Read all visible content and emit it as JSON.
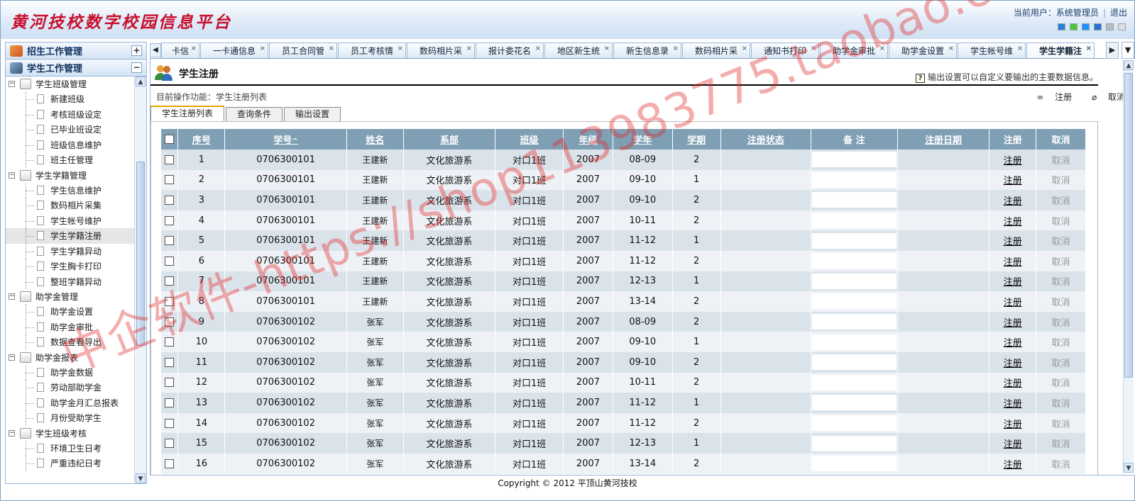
{
  "header": {
    "logo_text": "黄河技校数字校园信息平台",
    "user_label": "当前用户：系统管理员",
    "logout": "退出",
    "skin_colors": [
      "#2f7ed8",
      "#55c43b",
      "#1e90ff",
      "#2c6fd1",
      "#bbbbbb",
      "#dddddd"
    ]
  },
  "sidebar": {
    "sections": [
      {
        "label": "招生工作管理",
        "toggle": "+"
      },
      {
        "label": "学生工作管理",
        "toggle": "−"
      }
    ],
    "groups": [
      {
        "label": "学生班级管理",
        "items": [
          "新建班级",
          "考核班级设定",
          "已毕业班设定",
          "班级信息维护",
          "班主任管理"
        ]
      },
      {
        "label": "学生学籍管理",
        "items": [
          "学生信息维护",
          "数码相片采集",
          "学生帐号维护",
          "学生学籍注册",
          "学生学籍异动",
          "学生胸卡打印",
          "整班学籍异动"
        ]
      },
      {
        "label": "助学金管理",
        "items": [
          "助学金设置",
          "助学金审批",
          "数据查看导出"
        ]
      },
      {
        "label": "助学金报表",
        "items": [
          "助学金数据",
          "劳动部助学金",
          "助学金月汇总报表",
          "月份受助学生"
        ]
      },
      {
        "label": "学生班级考核",
        "items": [
          "环境卫生日考",
          "严重违纪日考"
        ]
      }
    ],
    "active_item": "学生学籍注册"
  },
  "tabs": [
    "卡信",
    "一卡通信息",
    "员工合同管",
    "员工考核情",
    "数码相片采",
    "报计委花名",
    "地区新生统",
    "新生信息录",
    "数码相片采",
    "通知书打印",
    "助学金审批",
    "助学金设置",
    "学生帐号维",
    "学生学籍注"
  ],
  "active_tab": "学生学籍注",
  "page": {
    "title": "学生注册",
    "hint": "输出设置可以自定义要输出的主要数据信息。",
    "crumb": "目前操作功能：学生注册列表",
    "action_register": "注册",
    "action_cancel": "取消"
  },
  "subtabs": [
    "学生注册列表",
    "查询条件",
    "输出设置"
  ],
  "table": {
    "headers": [
      "序号",
      "学号",
      "姓名",
      "系部",
      "班级",
      "年级",
      "学年",
      "学期",
      "注册状态",
      "备 注",
      "注册日期",
      "注册",
      "取消"
    ],
    "sort_mark": "^",
    "link_register": "注册",
    "link_cancel": "取消",
    "rows": [
      [
        "1",
        "0706300101",
        "王建新",
        "文化旅游系",
        "对口1班",
        "2007",
        "08-09",
        "2"
      ],
      [
        "2",
        "0706300101",
        "王建新",
        "文化旅游系",
        "对口1班",
        "2007",
        "09-10",
        "1"
      ],
      [
        "3",
        "0706300101",
        "王建新",
        "文化旅游系",
        "对口1班",
        "2007",
        "09-10",
        "2"
      ],
      [
        "4",
        "0706300101",
        "王建新",
        "文化旅游系",
        "对口1班",
        "2007",
        "10-11",
        "2"
      ],
      [
        "5",
        "0706300101",
        "王建新",
        "文化旅游系",
        "对口1班",
        "2007",
        "11-12",
        "1"
      ],
      [
        "6",
        "0706300101",
        "王建新",
        "文化旅游系",
        "对口1班",
        "2007",
        "11-12",
        "2"
      ],
      [
        "7",
        "0706300101",
        "王建新",
        "文化旅游系",
        "对口1班",
        "2007",
        "12-13",
        "1"
      ],
      [
        "8",
        "0706300101",
        "王建新",
        "文化旅游系",
        "对口1班",
        "2007",
        "13-14",
        "2"
      ],
      [
        "9",
        "0706300102",
        "张军",
        "文化旅游系",
        "对口1班",
        "2007",
        "08-09",
        "2"
      ],
      [
        "10",
        "0706300102",
        "张军",
        "文化旅游系",
        "对口1班",
        "2007",
        "09-10",
        "1"
      ],
      [
        "11",
        "0706300102",
        "张军",
        "文化旅游系",
        "对口1班",
        "2007",
        "09-10",
        "2"
      ],
      [
        "12",
        "0706300102",
        "张军",
        "文化旅游系",
        "对口1班",
        "2007",
        "10-11",
        "2"
      ],
      [
        "13",
        "0706300102",
        "张军",
        "文化旅游系",
        "对口1班",
        "2007",
        "11-12",
        "1"
      ],
      [
        "14",
        "0706300102",
        "张军",
        "文化旅游系",
        "对口1班",
        "2007",
        "11-12",
        "2"
      ],
      [
        "15",
        "0706300102",
        "张军",
        "文化旅游系",
        "对口1班",
        "2007",
        "12-13",
        "1"
      ],
      [
        "16",
        "0706300102",
        "张军",
        "文化旅游系",
        "对口1班",
        "2007",
        "13-14",
        "2"
      ]
    ]
  },
  "footer": "Copyright © 2012 平顶山黄河技校",
  "watermark": "中企软件-https://shop113983775.taobao.com"
}
